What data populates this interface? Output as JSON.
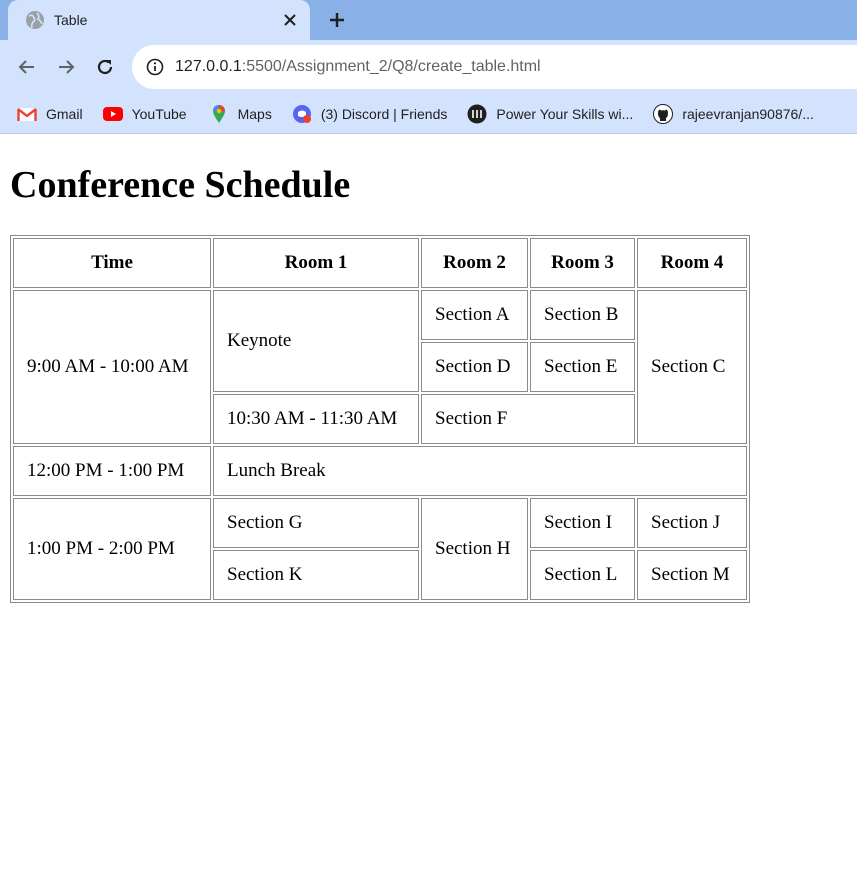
{
  "browser": {
    "tab_title": "Table",
    "url_host": "127.0.0.1",
    "url_rest": ":5500/Assignment_2/Q8/create_table.html",
    "bookmarks": [
      {
        "label": "Gmail",
        "icon": "gmail-icon"
      },
      {
        "label": "YouTube",
        "icon": "youtube-icon"
      },
      {
        "label": "Maps",
        "icon": "maps-icon"
      },
      {
        "label": "(3) Discord | Friends",
        "icon": "discord-icon"
      },
      {
        "label": "Power Your Skills wi...",
        "icon": "skills-icon"
      },
      {
        "label": "rajeevranjan90876/...",
        "icon": "github-icon"
      }
    ]
  },
  "page": {
    "heading": "Conference Schedule",
    "headers": [
      "Time",
      "Room 1",
      "Room 2",
      "Room 3",
      "Room 4"
    ],
    "cells": {
      "t1": "9:00 AM - 10:00 AM",
      "keynote": "Keynote",
      "secA": "Section A",
      "secB": "Section B",
      "secC": "Section C",
      "secD": "Section D",
      "secE": "Section E",
      "t2": "10:30 AM - 11:30 AM",
      "secF": "Section F",
      "t3": "12:00 PM - 1:00 PM",
      "lunch": "Lunch Break",
      "t4": "1:00 PM - 2:00 PM",
      "secG": "Section G",
      "secH": "Section H",
      "secI": "Section I",
      "secJ": "Section J",
      "secK": "Section K",
      "secL": "Section L",
      "secM": "Section M"
    }
  }
}
